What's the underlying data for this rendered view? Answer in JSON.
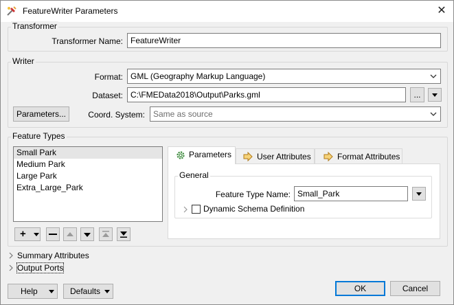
{
  "window": {
    "title": "FeatureWriter Parameters",
    "icon": "fme-wrench-icon",
    "close_icon": "close-icon"
  },
  "transformer": {
    "group_label": "Transformer",
    "name_label": "Transformer Name:",
    "name_value": "FeatureWriter"
  },
  "writer": {
    "group_label": "Writer",
    "format_label": "Format:",
    "format_value": "GML (Geography Markup Language)",
    "dataset_label": "Dataset:",
    "dataset_value": "C:\\FMEData2018\\Output\\Parks.gml",
    "browse_label": "...",
    "parameters_button": "Parameters...",
    "coord_label": "Coord. System:",
    "coord_placeholder": "Same as source"
  },
  "feature_types": {
    "group_label": "Feature Types",
    "items": [
      "Small Park",
      "Medium Park",
      "Large Park",
      "Extra_Large_Park"
    ],
    "selected_index": 0,
    "toolbar": {
      "add": "+",
      "remove": "—"
    }
  },
  "tabs": {
    "parameters": "Parameters",
    "user_attributes": "User Attributes",
    "format_attributes": "Format Attributes",
    "active": "parameters"
  },
  "general": {
    "group_label": "General",
    "feature_type_name_label": "Feature Type Name:",
    "feature_type_name_value": "Small_Park",
    "dynamic_schema_label": "Dynamic Schema Definition",
    "dynamic_schema_checked": false
  },
  "sections": {
    "summary_attributes": "Summary Attributes",
    "output_ports": "Output Ports"
  },
  "footer": {
    "help": "Help",
    "defaults": "Defaults",
    "ok": "OK",
    "cancel": "Cancel"
  },
  "colors": {
    "focus_blue": "#0078d7",
    "tab_arrow_orange": "#e8a23a",
    "gear_green": "#3d8b3d"
  }
}
